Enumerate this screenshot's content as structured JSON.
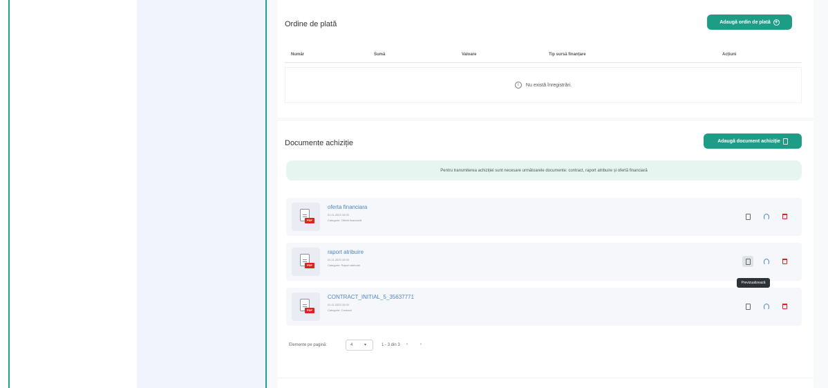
{
  "orders": {
    "title": "Ordine de plată",
    "add_button": "Adaugă ordin de plată",
    "columns": [
      "Număr",
      "Sumă",
      "Valoare",
      "Tip sursă finanțare",
      "Acțiuni"
    ],
    "empty_message": "Nu există înregistrări."
  },
  "documents": {
    "title": "Documente achiziție",
    "add_button": "Adaugă document achiziție",
    "notice": "Pentru transmiterea achiziției sunt necesare următoarele documente: contract, raport atribuire și ofertă financiară",
    "items": [
      {
        "name": "oferta financiara",
        "date": "01.11.2023 10:00",
        "category": "Categorie: Ofertă financiară"
      },
      {
        "name": "raport atribuire",
        "date": "01.11.2023 10:00",
        "category": "Categorie: Raport atribuire"
      },
      {
        "name": "CONTRACT_INITIAL_5_35637771",
        "date": "01.11.2023 10:00",
        "category": "Categorie: Contract"
      }
    ],
    "pdf_badge": "PDF",
    "tooltip": "Previzualizează"
  },
  "pagination": {
    "label": "Elemente pe pagină:",
    "per_page": "4",
    "range": "1 - 3 din 3",
    "prev": "‹",
    "next": "›"
  },
  "icons": {
    "add_order": "plus-circle-icon",
    "add_document": "document-icon",
    "empty": "info-icon",
    "view": "document-view-icon",
    "download": "download-icon",
    "delete": "trash-icon"
  },
  "colors": {
    "accent": "#1d9c86",
    "link": "#4a86c5",
    "danger": "#d9261c",
    "notice_bg": "#e6f5ef"
  }
}
